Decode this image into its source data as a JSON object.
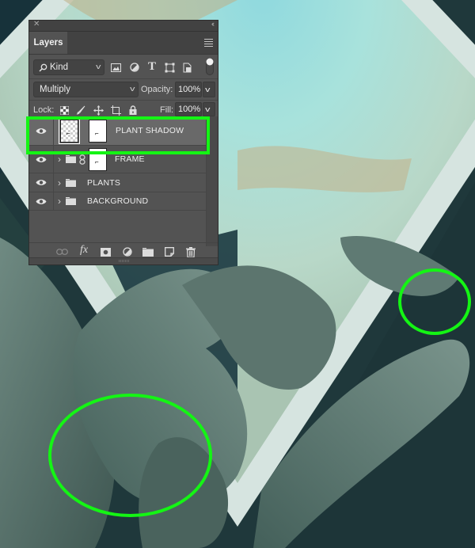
{
  "panel": {
    "title": "Layers",
    "close_icon": "close-icon",
    "collapse_icon": "double-chevron-icon",
    "menu_icon": "panel-menu-icon",
    "filter": {
      "kind_label": "Kind",
      "search_icon": "search-icon",
      "icons": [
        "pixel-layer-filter-icon",
        "adjustment-layer-filter-icon",
        "type-layer-filter-icon",
        "shape-layer-filter-icon",
        "smart-object-filter-icon",
        "filter-toggle-icon"
      ],
      "type_glyph": "T"
    },
    "blend_mode": "Multiply",
    "opacity_label": "Opacity:",
    "opacity_value": "100%",
    "lock_label": "Lock:",
    "lock_icons": [
      "lock-transparent-pixels-icon",
      "lock-image-pixels-icon",
      "lock-position-icon",
      "lock-artboard-icon",
      "lock-all-icon"
    ],
    "fill_label": "Fill:",
    "fill_value": "100%",
    "layers": [
      {
        "name": "PLANT SHADOW",
        "visible": true,
        "selected": true,
        "type": "layer-with-mask"
      },
      {
        "name": "FRAME",
        "visible": true,
        "selected": false,
        "type": "group-with-mask",
        "expand_glyph": "›"
      },
      {
        "name": "PLANTS",
        "visible": true,
        "selected": false,
        "type": "group",
        "expand_glyph": "›"
      },
      {
        "name": "BACKGROUND",
        "visible": true,
        "selected": false,
        "type": "group",
        "expand_glyph": "›"
      }
    ],
    "bottom_icons": [
      "link-layers-icon",
      "fx-icon",
      "add-mask-icon",
      "adjustment-layer-icon",
      "new-group-icon",
      "new-layer-icon",
      "delete-icon"
    ],
    "fx_label": "fx"
  },
  "colors": {
    "highlight": "#14f514",
    "panel_bg": "#535353",
    "selected_row": "#696969"
  },
  "annotations": [
    "highlight-plant-shadow-layer",
    "circle-shadow-left",
    "circle-shadow-right"
  ]
}
